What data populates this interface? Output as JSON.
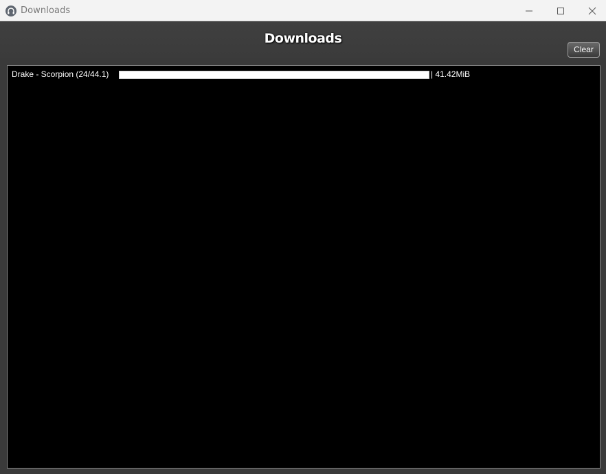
{
  "window": {
    "title": "Downloads",
    "icon": "headphones-icon",
    "controls": [
      "minimize-icon",
      "maximize-icon",
      "close-icon"
    ]
  },
  "header": {
    "title": "Downloads",
    "clear_label": "Clear"
  },
  "downloads": [
    {
      "name": "Drake - Scorpion (24/44.1)",
      "progress": 1.0,
      "size": "| 41.42MiB"
    }
  ],
  "colors": {
    "background": "#3a3a3a",
    "list_background": "#000000",
    "text": "#ffffff",
    "progress_fill": "#ffffff"
  }
}
